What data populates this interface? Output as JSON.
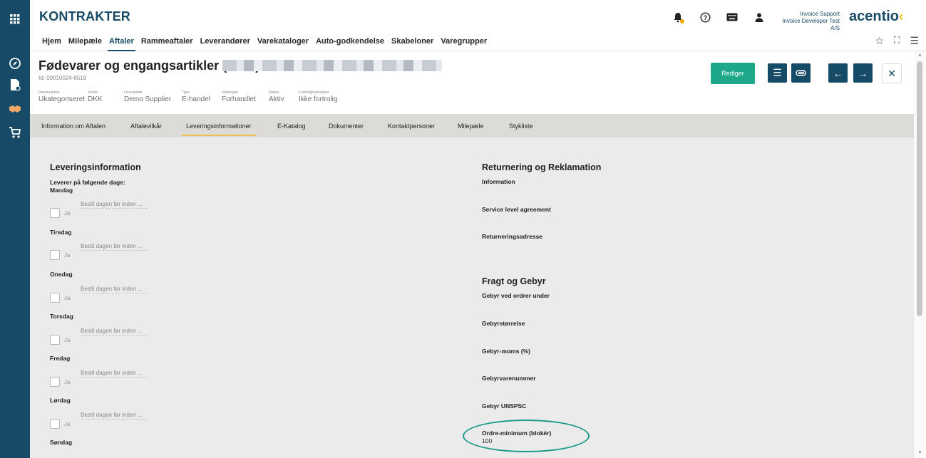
{
  "app": {
    "title": "KONTRAKTER",
    "brand": "acentio"
  },
  "user": {
    "name": "Invoice Support",
    "company": "Invoice Developer Test A/S"
  },
  "nav": {
    "items": [
      "Hjem",
      "Milepæle",
      "Aftaler",
      "Rammeaftaler",
      "Leverandører",
      "Varekataloger",
      "Auto-godkendelse",
      "Skabeloner",
      "Varegrupper"
    ],
    "active": "Aftaler"
  },
  "record": {
    "title": "Fødevarer og engangsartikler (2024)",
    "id": "Id: 09010024-8518",
    "meta": [
      {
        "label": "Rammeaftale",
        "value": "Ukategoriseret"
      },
      {
        "label": "Valuta",
        "value": "DKK"
      },
      {
        "label": "Leverandør",
        "value": "Demo Supplier"
      },
      {
        "label": "Type",
        "value": "E-handel"
      },
      {
        "label": "Undertype",
        "value": "Forhandlet"
      },
      {
        "label": "Status",
        "value": "Aktiv"
      },
      {
        "label": "Fortrolighedsstatus",
        "value": "Ikke fortrolig"
      }
    ],
    "edit_label": "Rediger"
  },
  "tabs": [
    "Information om Aftalen",
    "Aftalevilkår",
    "Leveringsinformationer",
    "E-Katalog",
    "Dokumenter",
    "Kontaktpersoner",
    "Milepæle",
    "Stykliste"
  ],
  "active_tab": "Leveringsinformationer",
  "delivery": {
    "title": "Leveringsinformation",
    "subtitle": "Leverer på følgende dage:",
    "checkbox_label": "Ja",
    "input_placeholder": "Bestil dagen før inden ...",
    "days": [
      "Mandag",
      "Tirsdag",
      "Onsdag",
      "Torsdag",
      "Fredag",
      "Lørdag",
      "Søndag"
    ]
  },
  "returns": {
    "title": "Returnering og Reklamation",
    "fields": [
      "Information",
      "Service level agreement",
      "Returneringsadresse"
    ]
  },
  "fees": {
    "title": "Fragt og Gebyr",
    "fields": [
      "Gebyr ved ordrer under",
      "Gebyrstørrelse",
      "Gebyr-moms (%)",
      "Gebyrvarenummer",
      "Gebyr UNSPSC"
    ],
    "order_min_label": "Ordre-minimum (blokér)",
    "order_min_value": "100"
  },
  "icons": {
    "rail": [
      "apps-grid-icon",
      "compass-icon",
      "document-icon",
      "handshake-icon",
      "cart-icon"
    ],
    "header": [
      "bell-icon",
      "help-icon",
      "keyboard-icon",
      "user-icon"
    ]
  },
  "colors": {
    "primary": "#164a66",
    "accent": "#1ea88a",
    "tab_underline": "#f0c14b",
    "highlight_ellipse": "#1b9a88"
  }
}
